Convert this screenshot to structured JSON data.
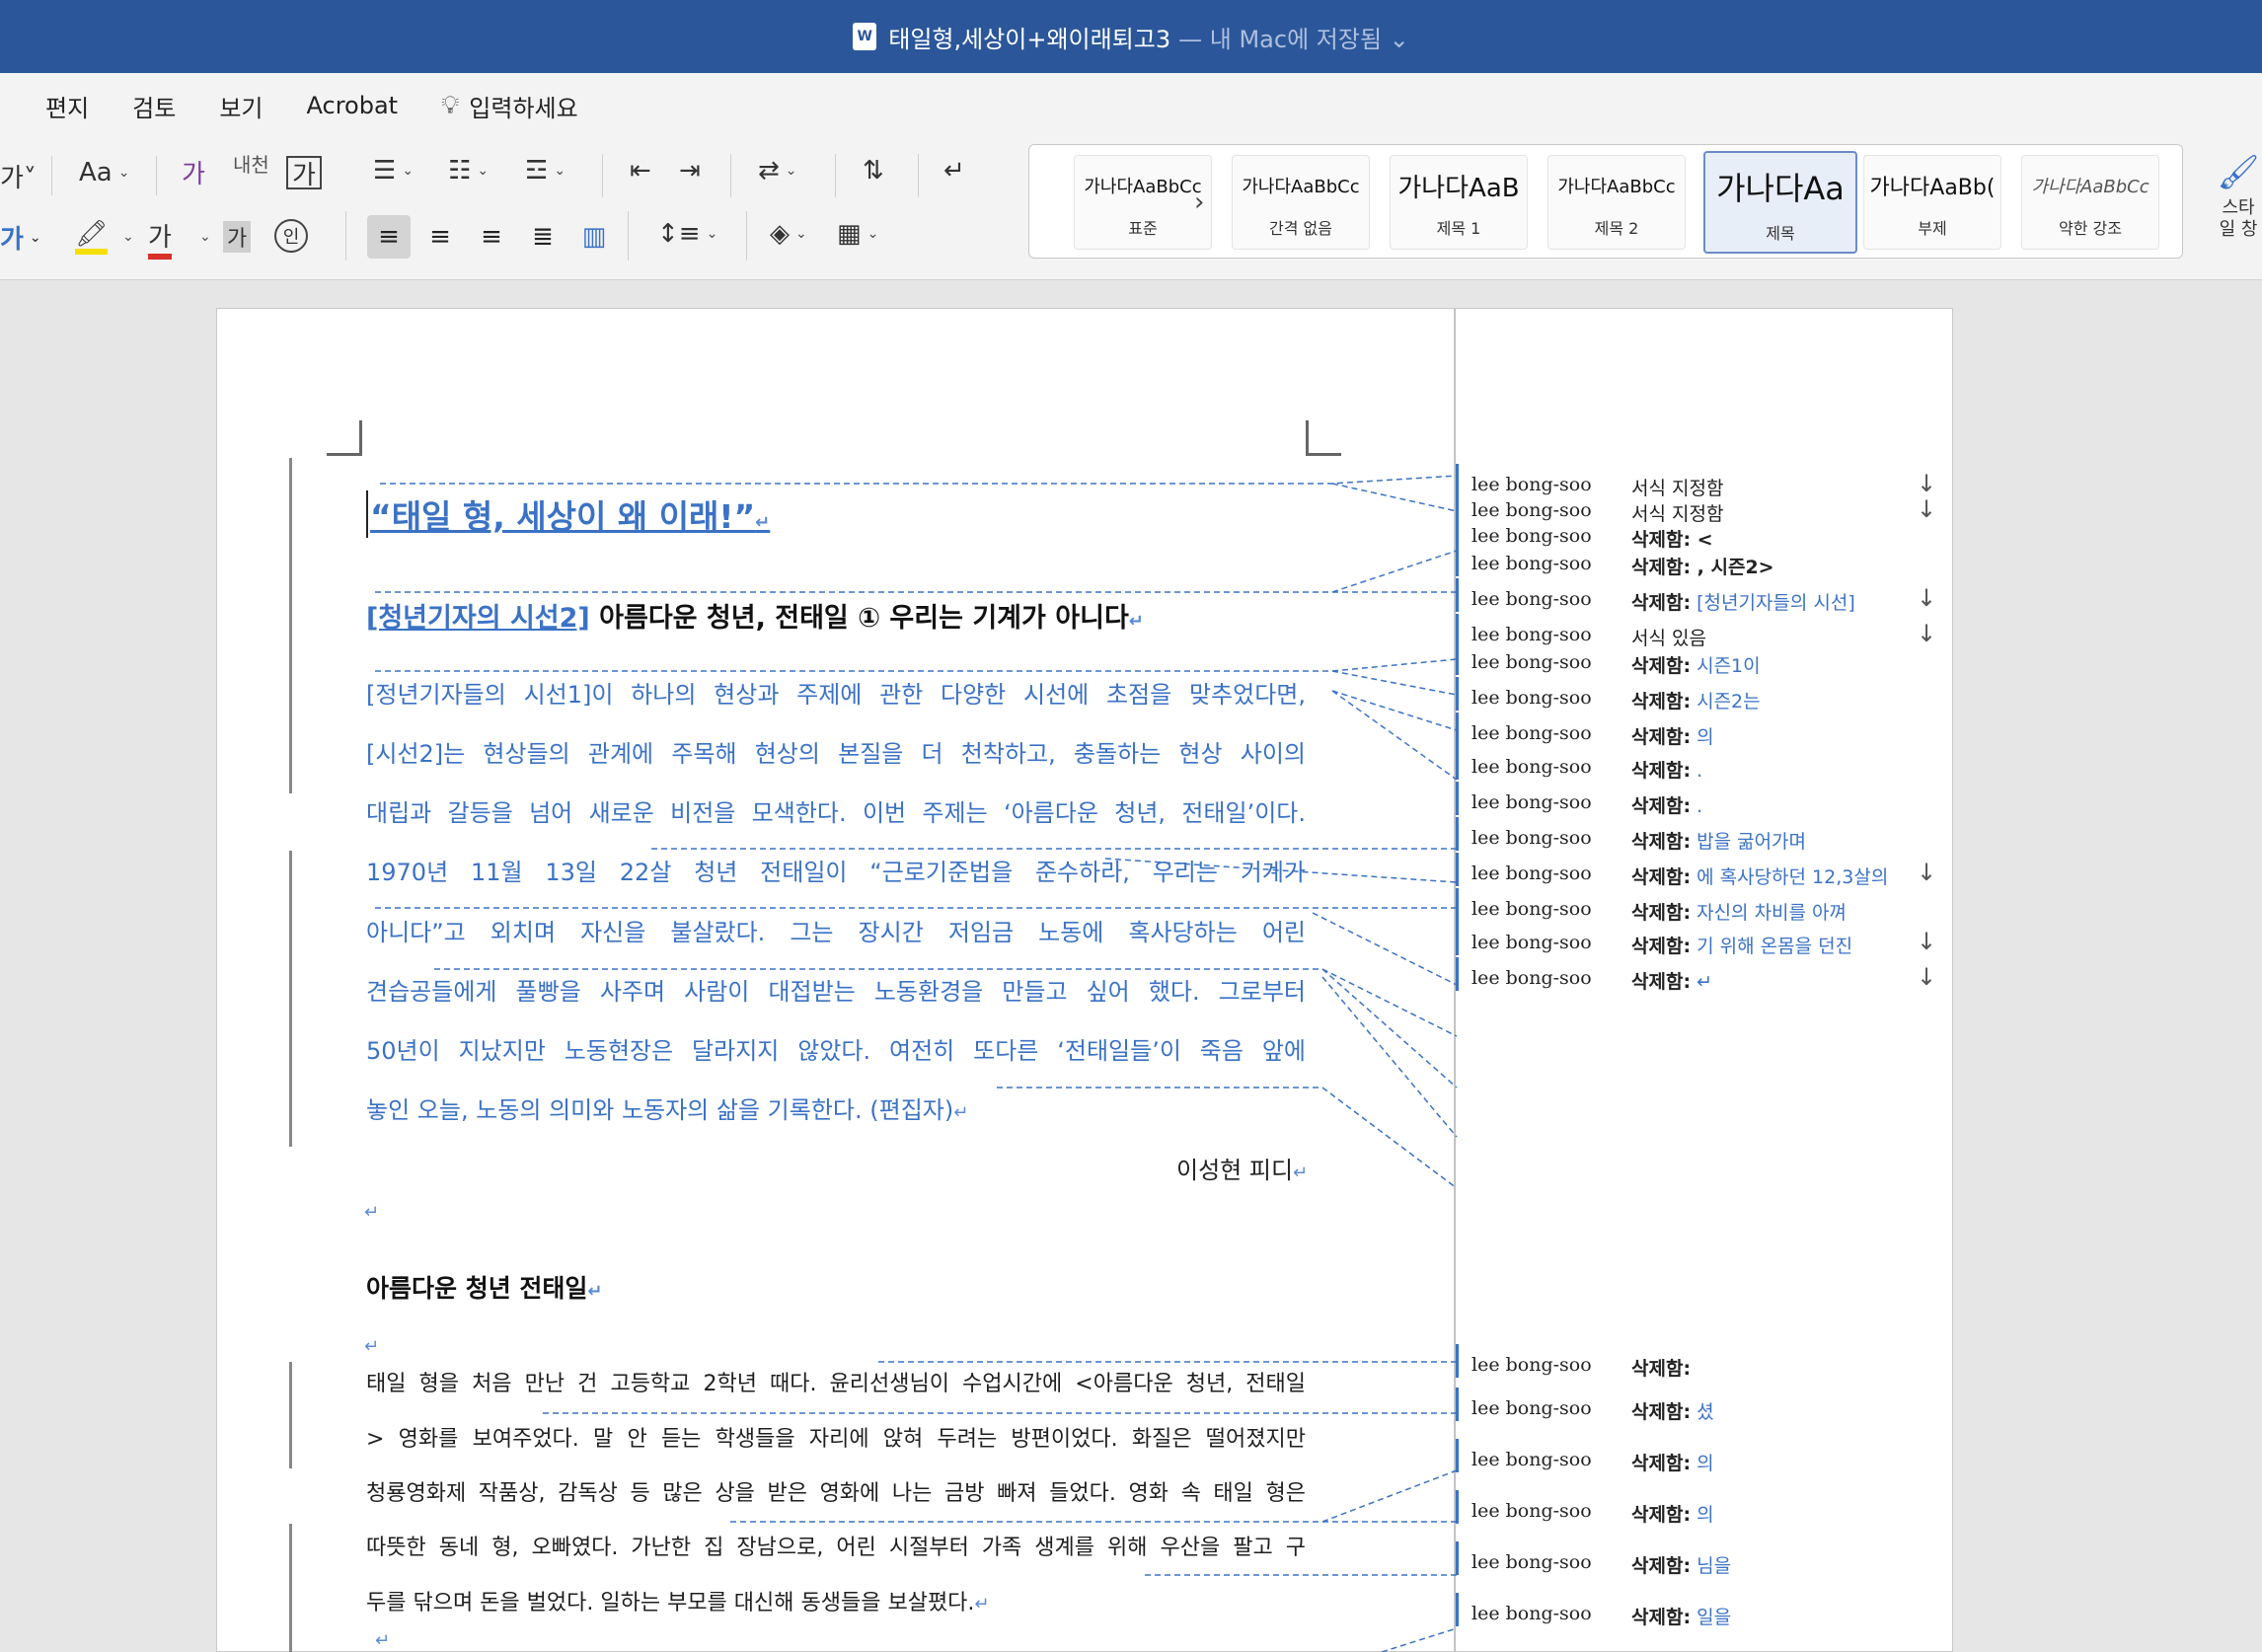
{
  "window": {
    "title": "태일형,세상이+왜이래퇴고3",
    "saved_state": "— 내 Mac에 저장됨 ⌄",
    "doc_icon": "W"
  },
  "menu": {
    "items": [
      "편지",
      "검토",
      "보기",
      "Acrobat"
    ],
    "tell_me": "입력하세요"
  },
  "ribbon": {
    "font_icon_partial": "가˅",
    "change_case": "Aa",
    "clear_format": "가",
    "phonetic_guide": "내천",
    "char_border": "가",
    "font_color_char": "가",
    "highlight_char": "가",
    "char_shading": "가",
    "enclose_char": "인",
    "styles": [
      {
        "preview": "가나다AaBbCc",
        "name": "표준"
      },
      {
        "preview": "가나다AaBbCc",
        "name": "간격 없음"
      },
      {
        "preview": "가나다AaB",
        "name": "제목 1"
      },
      {
        "preview": "가나다AaBbCc",
        "name": "제목 2"
      },
      {
        "preview": "가나다Aa",
        "name": "제목"
      },
      {
        "preview": "가나다AaBb(",
        "name": "부제"
      },
      {
        "preview": "가나다AaBbCc",
        "name": "약한 강조"
      }
    ],
    "styles_pane": "스타일 창",
    "colors": {
      "accent": "#2b579a",
      "highlight": "#f5e000",
      "font_red": "#d8302a"
    }
  },
  "document": {
    "headline": "“태일 형, 세상이 왜 이래!”",
    "subhead_a": "[청년기자의 시선2]",
    "subhead_b": " 아름다운 청년, 전태일 ① 우리는 기계가 아니다",
    "intro_lines": [
      "[정년기자들의 시선1]이 하나의 현상과 주제에 관한 다양한 시선에 초점을 맞추었다면,",
      "[시선2]는 현상들의 관계에 주목해 현상의 본질을 더 천착하고, 충돌하는 현상 사이의",
      "대립과 갈등을 넘어 새로운 비전을 모색한다. 이번 주제는 ‘아름다운 청년, 전태일’이다.",
      "1970년 11월 13일 22살 청년 전태일이 “근로기준법을 준수하라, 우리는 기계가",
      "아니다”고 외치며 자신을 불살랐다. 그는 장시간 저임금 노동에 혹사당하는 어린",
      "견습공들에게 풀빵을 사주며 사람이 대접받는 노동환경을 만들고 싶어 했다. 그로부터",
      "50년이 지났지만 노동현장은 달라지지 않았다. 여전히 또다른 ‘전태일들’이 죽음 앞에"
    ],
    "intro_last": "놓인 오늘, 노동의 의미와 노동자의 삶을 기록한다. (편집자)",
    "byline": "이성현 피디",
    "section_title": "아름다운 청년 전태일",
    "body_lines": [
      " 태일 형을 처음 만난 건 고등학교 2학년 때다. 윤리선생님이 수업시간에 <아름다운 청년, 전태일",
      "> 영화를 보여주었다. 말 안 듣는 학생들을 자리에 앉혀 두려는 방편이었다. 화질은 떨어졌지만",
      "청룡영화제 작품상, 감독상 등 많은 상을 받은 영화에 나는 금방 빠져 들었다. 영화 속 태일 형은",
      "따뜻한 동네 형, 오빠였다. 가난한 집 장남으로, 어린 시절부터 가족 생계를 위해 우산을 팔고 구"
    ],
    "body_last": "두를 닦으며 돈을 벌었다. 일하는 부모를 대신해 동생들을 보살폈다.",
    "paragraph_mark": "↵"
  },
  "markup": {
    "author": "lee bong-soo",
    "deleted_label": "삭제함:",
    "balloons_top": [
      {
        "label": "서식 지정함",
        "deleted": "",
        "arrow": true
      },
      {
        "label": "서식 지정함",
        "deleted": "",
        "arrow": true
      },
      {
        "label": "삭제함:",
        "deleted": "<",
        "bold_del": true,
        "arrow": false
      },
      {
        "label": "삭제함:",
        "deleted": ", 시즌2>",
        "bold_del": true,
        "arrow": false
      },
      {
        "label": "삭제함:",
        "deleted": "[청년기자들의 시선]",
        "arrow": true
      },
      {
        "label": "서식 있음",
        "deleted": "",
        "arrow": true
      },
      {
        "label": "삭제함:",
        "deleted": "시즌1이",
        "arrow": false
      },
      {
        "label": "삭제함:",
        "deleted": "시즌2는",
        "arrow": false
      },
      {
        "label": "삭제함:",
        "deleted": "의",
        "arrow": false
      },
      {
        "label": "삭제함:",
        "deleted": ".",
        "arrow": false
      },
      {
        "label": "삭제함:",
        "deleted": ".",
        "arrow": false
      },
      {
        "label": "삭제함:",
        "deleted": "밥을 굶어가며",
        "arrow": false
      },
      {
        "label": "삭제함:",
        "deleted": "에 혹사당하던 12,3살의",
        "arrow": true
      },
      {
        "label": "삭제함:",
        "deleted": "자신의 차비를 아껴",
        "arrow": false
      },
      {
        "label": "삭제함:",
        "deleted": "기 위해 온몸을 던진",
        "arrow": true
      },
      {
        "label": "삭제함:",
        "deleted": "↵",
        "arrow": true
      }
    ],
    "balloons_bottom": [
      {
        "label": "삭제함:",
        "deleted": ""
      },
      {
        "label": "삭제함:",
        "deleted": "셨"
      },
      {
        "label": "삭제함:",
        "deleted": "의"
      },
      {
        "label": "삭제함:",
        "deleted": "의"
      },
      {
        "label": "삭제함:",
        "deleted": "님을"
      },
      {
        "label": "삭제함:",
        "deleted": "일을"
      }
    ],
    "colors": {
      "markup": "#3b72c5"
    }
  }
}
